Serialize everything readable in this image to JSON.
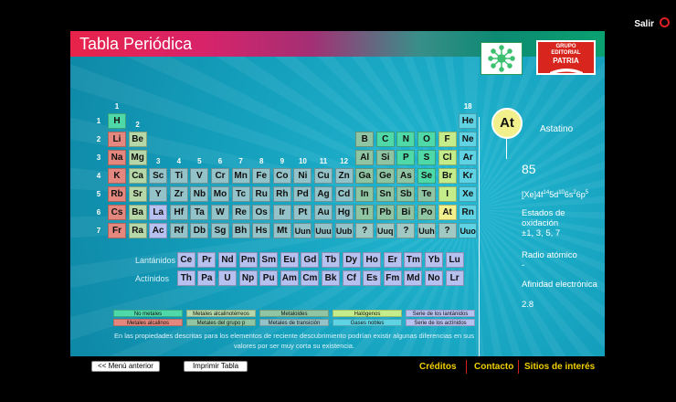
{
  "topbar": {
    "exit_label": "Salir"
  },
  "header": {
    "title": "Tabla Periódica"
  },
  "logos": {
    "publisher": [
      "GRUPO",
      "EDITORIAL",
      "PATRIA"
    ]
  },
  "colors": {
    "alkali": "#e3877f",
    "alkaline": "#b6d8a8",
    "nonmetal": "#4fd8a8",
    "metalloid": "#8fc5a2",
    "transition": "#93c2c8",
    "postTransition": "#8fc5a2",
    "halogen": "#c5ec8a",
    "noble": "#5fd2e3",
    "lanthanide": "#b7c1f0",
    "actinide": "#b7c1f0",
    "unknown": "#9fc9c2",
    "selected": "#f2f08c"
  },
  "groups": [
    "1",
    "2",
    "3",
    "4",
    "5",
    "6",
    "7",
    "8",
    "9",
    "10",
    "11",
    "12",
    "13",
    "14",
    "15",
    "16",
    "17",
    "18"
  ],
  "periods": [
    "1",
    "2",
    "3",
    "4",
    "5",
    "6",
    "7"
  ],
  "elements": [
    {
      "s": "H",
      "p": 1,
      "g": 1,
      "c": "nonmetal"
    },
    {
      "s": "He",
      "p": 1,
      "g": 18,
      "c": "noble"
    },
    {
      "s": "Li",
      "p": 2,
      "g": 1,
      "c": "alkali"
    },
    {
      "s": "Be",
      "p": 2,
      "g": 2,
      "c": "alkaline"
    },
    {
      "s": "B",
      "p": 2,
      "g": 13,
      "c": "metalloid"
    },
    {
      "s": "C",
      "p": 2,
      "g": 14,
      "c": "nonmetal"
    },
    {
      "s": "N",
      "p": 2,
      "g": 15,
      "c": "nonmetal"
    },
    {
      "s": "O",
      "p": 2,
      "g": 16,
      "c": "nonmetal"
    },
    {
      "s": "F",
      "p": 2,
      "g": 17,
      "c": "halogen"
    },
    {
      "s": "Ne",
      "p": 2,
      "g": 18,
      "c": "noble"
    },
    {
      "s": "Na",
      "p": 3,
      "g": 1,
      "c": "alkali"
    },
    {
      "s": "Mg",
      "p": 3,
      "g": 2,
      "c": "alkaline"
    },
    {
      "s": "Al",
      "p": 3,
      "g": 13,
      "c": "postTransition"
    },
    {
      "s": "Si",
      "p": 3,
      "g": 14,
      "c": "metalloid"
    },
    {
      "s": "P",
      "p": 3,
      "g": 15,
      "c": "nonmetal"
    },
    {
      "s": "S",
      "p": 3,
      "g": 16,
      "c": "nonmetal"
    },
    {
      "s": "Cl",
      "p": 3,
      "g": 17,
      "c": "halogen"
    },
    {
      "s": "Ar",
      "p": 3,
      "g": 18,
      "c": "noble"
    },
    {
      "s": "K",
      "p": 4,
      "g": 1,
      "c": "alkali"
    },
    {
      "s": "Ca",
      "p": 4,
      "g": 2,
      "c": "alkaline"
    },
    {
      "s": "Sc",
      "p": 4,
      "g": 3,
      "c": "transition"
    },
    {
      "s": "Ti",
      "p": 4,
      "g": 4,
      "c": "transition"
    },
    {
      "s": "V",
      "p": 4,
      "g": 5,
      "c": "transition"
    },
    {
      "s": "Cr",
      "p": 4,
      "g": 6,
      "c": "transition"
    },
    {
      "s": "Mn",
      "p": 4,
      "g": 7,
      "c": "transition"
    },
    {
      "s": "Fe",
      "p": 4,
      "g": 8,
      "c": "transition"
    },
    {
      "s": "Co",
      "p": 4,
      "g": 9,
      "c": "transition"
    },
    {
      "s": "Ni",
      "p": 4,
      "g": 10,
      "c": "transition"
    },
    {
      "s": "Cu",
      "p": 4,
      "g": 11,
      "c": "transition"
    },
    {
      "s": "Zn",
      "p": 4,
      "g": 12,
      "c": "transition"
    },
    {
      "s": "Ga",
      "p": 4,
      "g": 13,
      "c": "postTransition"
    },
    {
      "s": "Ge",
      "p": 4,
      "g": 14,
      "c": "metalloid"
    },
    {
      "s": "As",
      "p": 4,
      "g": 15,
      "c": "metalloid"
    },
    {
      "s": "Se",
      "p": 4,
      "g": 16,
      "c": "nonmetal"
    },
    {
      "s": "Br",
      "p": 4,
      "g": 17,
      "c": "halogen"
    },
    {
      "s": "Kr",
      "p": 4,
      "g": 18,
      "c": "noble"
    },
    {
      "s": "Rb",
      "p": 5,
      "g": 1,
      "c": "alkali"
    },
    {
      "s": "Sr",
      "p": 5,
      "g": 2,
      "c": "alkaline"
    },
    {
      "s": "Y",
      "p": 5,
      "g": 3,
      "c": "transition"
    },
    {
      "s": "Zr",
      "p": 5,
      "g": 4,
      "c": "transition"
    },
    {
      "s": "Nb",
      "p": 5,
      "g": 5,
      "c": "transition"
    },
    {
      "s": "Mo",
      "p": 5,
      "g": 6,
      "c": "transition"
    },
    {
      "s": "Tc",
      "p": 5,
      "g": 7,
      "c": "transition"
    },
    {
      "s": "Ru",
      "p": 5,
      "g": 8,
      "c": "transition"
    },
    {
      "s": "Rh",
      "p": 5,
      "g": 9,
      "c": "transition"
    },
    {
      "s": "Pd",
      "p": 5,
      "g": 10,
      "c": "transition"
    },
    {
      "s": "Ag",
      "p": 5,
      "g": 11,
      "c": "transition"
    },
    {
      "s": "Cd",
      "p": 5,
      "g": 12,
      "c": "transition"
    },
    {
      "s": "In",
      "p": 5,
      "g": 13,
      "c": "postTransition"
    },
    {
      "s": "Sn",
      "p": 5,
      "g": 14,
      "c": "postTransition"
    },
    {
      "s": "Sb",
      "p": 5,
      "g": 15,
      "c": "metalloid"
    },
    {
      "s": "Te",
      "p": 5,
      "g": 16,
      "c": "metalloid"
    },
    {
      "s": "I",
      "p": 5,
      "g": 17,
      "c": "halogen"
    },
    {
      "s": "Xe",
      "p": 5,
      "g": 18,
      "c": "noble"
    },
    {
      "s": "Cs",
      "p": 6,
      "g": 1,
      "c": "alkali"
    },
    {
      "s": "Ba",
      "p": 6,
      "g": 2,
      "c": "alkaline"
    },
    {
      "s": "La",
      "p": 6,
      "g": 3,
      "c": "lanthanide"
    },
    {
      "s": "Hf",
      "p": 6,
      "g": 4,
      "c": "transition"
    },
    {
      "s": "Ta",
      "p": 6,
      "g": 5,
      "c": "transition"
    },
    {
      "s": "W",
      "p": 6,
      "g": 6,
      "c": "transition"
    },
    {
      "s": "Re",
      "p": 6,
      "g": 7,
      "c": "transition"
    },
    {
      "s": "Os",
      "p": 6,
      "g": 8,
      "c": "transition"
    },
    {
      "s": "Ir",
      "p": 6,
      "g": 9,
      "c": "transition"
    },
    {
      "s": "Pt",
      "p": 6,
      "g": 10,
      "c": "transition"
    },
    {
      "s": "Au",
      "p": 6,
      "g": 11,
      "c": "transition"
    },
    {
      "s": "Hg",
      "p": 6,
      "g": 12,
      "c": "transition"
    },
    {
      "s": "Tl",
      "p": 6,
      "g": 13,
      "c": "postTransition"
    },
    {
      "s": "Pb",
      "p": 6,
      "g": 14,
      "c": "postTransition"
    },
    {
      "s": "Bi",
      "p": 6,
      "g": 15,
      "c": "postTransition"
    },
    {
      "s": "Po",
      "p": 6,
      "g": 16,
      "c": "metalloid"
    },
    {
      "s": "At",
      "p": 6,
      "g": 17,
      "c": "selected"
    },
    {
      "s": "Rn",
      "p": 6,
      "g": 18,
      "c": "noble"
    },
    {
      "s": "Fr",
      "p": 7,
      "g": 1,
      "c": "alkali"
    },
    {
      "s": "Ra",
      "p": 7,
      "g": 2,
      "c": "alkaline"
    },
    {
      "s": "Ac",
      "p": 7,
      "g": 3,
      "c": "actinide"
    },
    {
      "s": "Rf",
      "p": 7,
      "g": 4,
      "c": "transition"
    },
    {
      "s": "Db",
      "p": 7,
      "g": 5,
      "c": "transition"
    },
    {
      "s": "Sg",
      "p": 7,
      "g": 6,
      "c": "transition"
    },
    {
      "s": "Bh",
      "p": 7,
      "g": 7,
      "c": "transition"
    },
    {
      "s": "Hs",
      "p": 7,
      "g": 8,
      "c": "transition"
    },
    {
      "s": "Mt",
      "p": 7,
      "g": 9,
      "c": "transition"
    },
    {
      "s": "Uun",
      "p": 7,
      "g": 10,
      "c": "transition"
    },
    {
      "s": "Uuu",
      "p": 7,
      "g": 11,
      "c": "transition"
    },
    {
      "s": "Uub",
      "p": 7,
      "g": 12,
      "c": "transition"
    },
    {
      "s": "?",
      "p": 7,
      "g": 13,
      "c": "unknown"
    },
    {
      "s": "Uuq",
      "p": 7,
      "g": 14,
      "c": "unknown"
    },
    {
      "s": "?",
      "p": 7,
      "g": 15,
      "c": "unknown"
    },
    {
      "s": "Uuh",
      "p": 7,
      "g": 16,
      "c": "unknown"
    },
    {
      "s": "?",
      "p": 7,
      "g": 17,
      "c": "unknown"
    },
    {
      "s": "Uuo",
      "p": 7,
      "g": 18,
      "c": "noble"
    }
  ],
  "f_block": {
    "lanthanides_label": "Lantánidos",
    "actinides_label": "Actínidos",
    "lanthanides": [
      "Ce",
      "Pr",
      "Nd",
      "Pm",
      "Sm",
      "Eu",
      "Gd",
      "Tb",
      "Dy",
      "Ho",
      "Er",
      "Tm",
      "Yb",
      "Lu"
    ],
    "actinides": [
      "Th",
      "Pa",
      "U",
      "Np",
      "Pu",
      "Am",
      "Cm",
      "Bk",
      "Cf",
      "Es",
      "Fm",
      "Md",
      "No",
      "Lr"
    ]
  },
  "legend": [
    {
      "label": "No metales",
      "color": "#4fd8a8"
    },
    {
      "label": "Metales alcalinos",
      "color": "#e3877f"
    },
    {
      "label": "Metales alcalinotérreos",
      "color": "#b6d8a8"
    },
    {
      "label": "Metales del grupo p",
      "color": "#8fc5a2"
    },
    {
      "label": "Metaloides",
      "color": "#8fc5a2"
    },
    {
      "label": "Metales de transición",
      "color": "#93c2c8"
    },
    {
      "label": "Halógenos",
      "color": "#c5ec8a"
    },
    {
      "label": "Gases nobles",
      "color": "#5fd2e3"
    },
    {
      "label": "Serie de los lantánidos",
      "color": "#b7c1f0"
    },
    {
      "label": "Serie de los actínidos",
      "color": "#b7c1f0"
    }
  ],
  "note": "En las propiedades descritas para los elementos de reciente descubrimiento podrían existir algunas diferencias en sus valores por ser muy corta su existencia.",
  "selected": {
    "symbol": "At",
    "name": "Astatino",
    "atomic_number": "85",
    "config_base": "[Xe]4f",
    "config_sup1": "14",
    "config_mid1": "5d",
    "config_sup2": "10",
    "config_mid2": "6s",
    "config_sup3": "2",
    "config_mid3": "6p",
    "config_sup4": "5",
    "oxidation_label": "Estados de oxidación",
    "oxidation_value": "±1, 3, 5, 7",
    "radius_label": "Radio atómico",
    "radius_value": "-",
    "affinity_label": "Afinidad electrónica",
    "affinity_value": "2.8"
  },
  "footer": {
    "back_label": "<< Menú anterior",
    "print_label": "Imprimir Tabla",
    "credits": "Créditos",
    "contact": "Contacto",
    "sites": "Sitios de interés"
  }
}
